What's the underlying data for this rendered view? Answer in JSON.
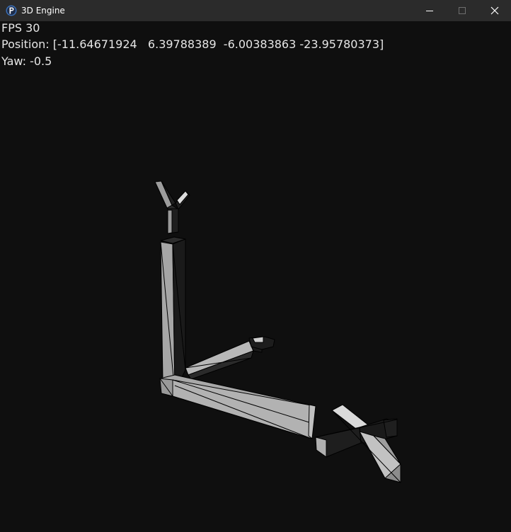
{
  "window": {
    "title": "3D Engine",
    "app_icon": "p-logo-icon",
    "controls": [
      "minimize-icon",
      "maximize-icon",
      "close-icon"
    ]
  },
  "hud": {
    "fps": "FPS 30",
    "position": "Position: [-11.64671924   6.39788389  -6.00383863 -23.95780373]",
    "yaw": "Yaw: -0.5"
  },
  "colors": {
    "background": "#0f0f0f",
    "titlebar": "#2b2b2b",
    "hud_text": "#e6e6e6",
    "face_light": "#a8a8a8",
    "face_dark": "#1f1f1f",
    "edge": "#000000"
  }
}
